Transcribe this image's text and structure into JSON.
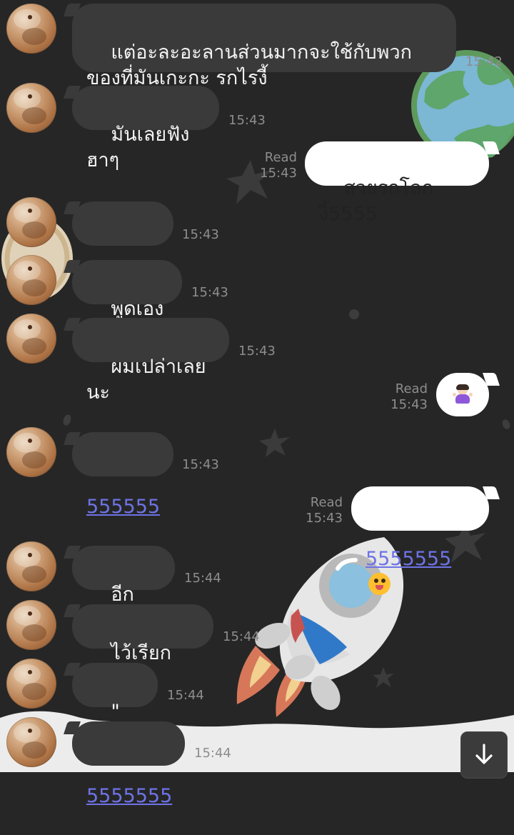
{
  "messages": [
    {
      "sender": "friend",
      "text": "แต่อะละอะลานส่วนมากจะใช้กับพวก\nของที่มันเกะกะ รกไรงี้",
      "time": "15:42"
    },
    {
      "sender": "friend",
      "text": "มันเลยฟังฮาๆ",
      "time": "15:43"
    },
    {
      "sender": "me",
      "text": "สวยรกโลกงี้5555",
      "status": "Read",
      "time": "15:43"
    },
    {
      "sender": "friend",
      "text": "555555",
      "time": "15:43"
    },
    {
      "sender": "friend",
      "text": "พูดเองนะ",
      "time": "15:43"
    },
    {
      "sender": "friend",
      "text": "ผมเปล่าเลยนะ",
      "time": "15:43"
    },
    {
      "sender": "me",
      "text": "🤷🏻‍♀️",
      "status": "Read",
      "time": "15:43"
    },
    {
      "sender": "friend",
      "text": "555555",
      "time": "15:43"
    },
    {
      "sender": "me",
      "text": "5555555",
      "status": "Read",
      "time": "15:43"
    },
    {
      "sender": "friend",
      "text": "อีกคำนึง",
      "time": "15:44"
    },
    {
      "sender": "friend",
      "text": "ไว้เรียกเพื่อน",
      "time": "15:44"
    },
    {
      "sender": "friend",
      "text": "\" เบย \"",
      "time": "15:44"
    },
    {
      "sender": "friend",
      "text": "5555555",
      "time": "15:44"
    }
  ],
  "icons": {
    "avatar": "profile-photo",
    "scroll_button": "arrow-down-icon",
    "emoji_shrug": "person-shrugging",
    "emoji_laugh": "rolling-on-the-floor-laughing"
  },
  "colors": {
    "background": "#262626",
    "incoming_bubble": "#3a3a3a",
    "outgoing_bubble": "#ffffff",
    "link": "#6e73e6",
    "time": "#8d8d8d"
  }
}
